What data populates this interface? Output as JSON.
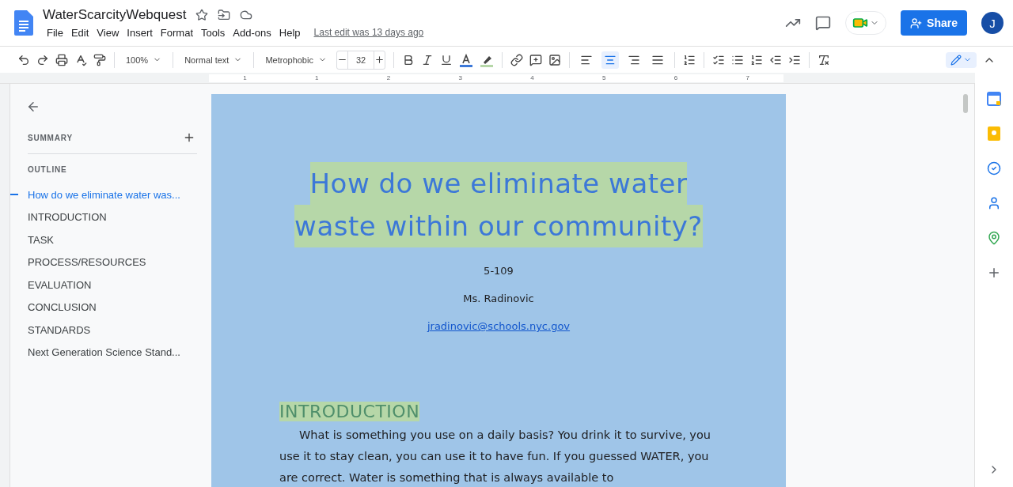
{
  "document": {
    "title": "WaterScarcityWebquest",
    "last_edit": "Last edit was 13 days ago"
  },
  "menu": [
    "File",
    "Edit",
    "View",
    "Insert",
    "Format",
    "Tools",
    "Add-ons",
    "Help"
  ],
  "share": {
    "label": "Share"
  },
  "avatar": {
    "initial": "J"
  },
  "toolbar": {
    "zoom": "100%",
    "style": "Normal text",
    "font": "Metrophobic",
    "size": "32",
    "align": [
      {
        "kind": "left",
        "selected": false
      },
      {
        "kind": "center",
        "selected": true
      },
      {
        "kind": "right",
        "selected": false
      },
      {
        "kind": "justify",
        "selected": false
      }
    ]
  },
  "ruler": [
    "1",
    "1",
    "2",
    "3",
    "4",
    "5",
    "6",
    "7"
  ],
  "outline": {
    "summary": "SUMMARY",
    "heading": "OUTLINE",
    "items": [
      {
        "label": "How do we eliminate water was...",
        "selected": true
      },
      {
        "label": "INTRODUCTION",
        "selected": false
      },
      {
        "label": "TASK",
        "selected": false
      },
      {
        "label": "PROCESS/RESOURCES",
        "selected": false
      },
      {
        "label": "EVALUATION",
        "selected": false
      },
      {
        "label": "CONCLUSION",
        "selected": false
      },
      {
        "label": "STANDARDS",
        "selected": false
      },
      {
        "label": "Next Generation Science Stand...",
        "selected": false
      }
    ]
  },
  "page": {
    "title_lines": [
      "How do we eliminate water",
      "waste within our community?"
    ],
    "class": "5-109",
    "teacher": "Ms. Radinovic",
    "email": "jradinovic@schools.nyc.gov",
    "section_heading": "INTRODUCTION",
    "paragraph": "What is something you use on a daily basis? You drink it to survive, you use it to stay clean, you can use it to have fun. If you guessed WATER, you are correct. Water is something that is always available to"
  }
}
